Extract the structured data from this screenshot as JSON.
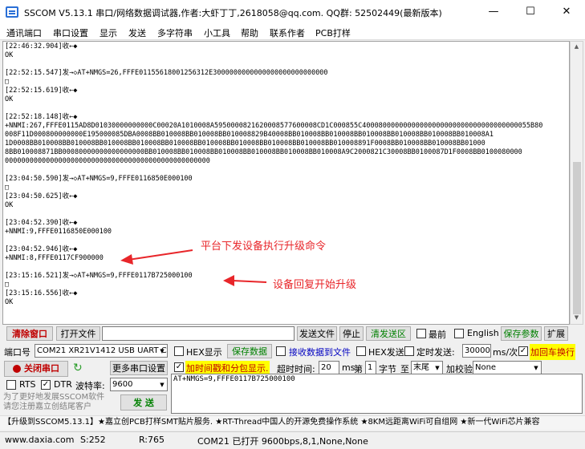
{
  "window": {
    "title": "SSCOM V5.13.1 串口/网络数据调试器,作者:大虾丁丁,2618058@qq.com. QQ群: 52502449(最新版本)",
    "minimize": "—",
    "maximize": "☐",
    "close": "✕"
  },
  "menu": [
    "通讯端口",
    "串口设置",
    "显示",
    "发送",
    "多字符串",
    "小工具",
    "帮助",
    "联系作者",
    "PCB打样"
  ],
  "log_lines": [
    "[22:46:32.904]收←◆",
    "OK",
    "",
    "[22:52:15.547]发→◇AT+NMGS=26,FFFE01155618001256312E3000000000000000000000000000",
    "□",
    "[22:52:15.619]收←◆",
    "OK",
    "",
    "[22:52:18.148]收←◆",
    "+NNMI:267,FFFE0115AD8D01030000000000C00020A1010008A5950000821620008577600008CD1C000855C40008000000000000000000000000000000000055B80",
    "008F11D000800000000E195000085DBA0008BB010008BB010008BB010008829B40008BB010008BB010008BB010008BB010008BB010008BB010008A1",
    "1D0008BB010008BB010008BB010008BB010008BB010008BB010008BB010008BB010008BB010008BB010008891F0008BB010008BB010008BB01000",
    "8BB010008871BB00080000000000000000BB010008BB010008BB010008BB010008BB010008BB010008A9C2000821C30008BB0100087D1F0008BB0100080000",
    "00000000000000000000000000000000000000000000000000",
    "",
    "[23:04:50.590]发→◇AT+NMGS=9,FFFE0116850E000100",
    "□",
    "[23:04:50.625]收←◆",
    "OK",
    "",
    "[23:04:52.390]收←◆",
    "+NNMI:9,FFFE0116850E000100",
    "",
    "[23:04:52.946]收←◆",
    "+NNMI:8,FFFE0117CF900000",
    "",
    "[23:15:16.521]发→◇AT+NMGS=9,FFFE0117B725000100",
    "□",
    "[23:15:16.556]收←◆",
    "OK"
  ],
  "annotations": {
    "a1": "平台下发设备执行升级命令",
    "a2": "设备回复开始升级"
  },
  "toolbar": {
    "clear": "清除窗口",
    "open_file": "打开文件",
    "send_file": "发送文件",
    "stop": "停止",
    "clear_send": "清发送区",
    "topmost": "最前",
    "english": "English",
    "save_params": "保存参数",
    "expand": "扩展"
  },
  "port": {
    "label": "端口号",
    "value": "COM21 XR21V1412 USB UART C",
    "hex_display": "HEX显示",
    "save_data": "保存数据",
    "recv_to_file": "接收数据到文件",
    "hex_send": "HEX发送",
    "timed_send": "定时发送:",
    "interval": "30000",
    "interval_unit": "ms/次",
    "add_crlf": "加回车换行",
    "close_port": "关闭串口",
    "more_settings": "更多串口设置",
    "timestamp": "加时间戳和分包显示.",
    "timeout_label": "超时时间:",
    "timeout": "20",
    "ms": "ms",
    "nth": "第",
    "byte_num": "1",
    "byte_label": "字节",
    "to": "至",
    "end": "末尾",
    "checksum_label": "加校验",
    "checksum": "None",
    "rts": "RTS",
    "dtr": "DTR",
    "baud_label": "波特率:",
    "baud": "9600",
    "send_text": "AT+NMGS=9,FFFE0117B725000100",
    "promo": "为了更好地发展SSCOM软件\n请您注册嘉立创结尾客户",
    "send_btn": "发 送"
  },
  "marquee": "【升级到SSCOM5.13.1】★嘉立创PCB打样SMT贴片服务. ★RT-Thread中国人的开源免费操作系统 ★8KM远距离WiFi可自组网 ★新一代WiFi芯片兼容",
  "status": {
    "site": "www.daxia.com",
    "s": "S:252",
    "r": "R:765",
    "port_state": "COM21 已打开  9600bps,8,1,None,None"
  }
}
